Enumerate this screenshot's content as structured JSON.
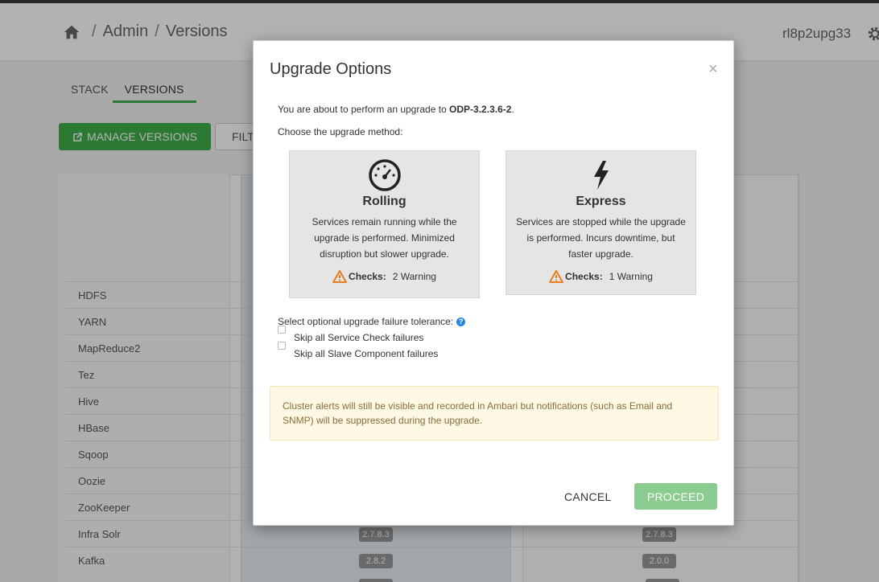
{
  "header": {
    "breadcrumb": [
      "Admin",
      "Versions"
    ],
    "user": "rl8p2upg33"
  },
  "tabs": [
    "STACK",
    "VERSIONS"
  ],
  "toolbar": {
    "manage_label": "MANAGE VERSIONS",
    "filter_label": "FILT"
  },
  "services": [
    "HDFS",
    "YARN",
    "MapReduce2",
    "Tez",
    "Hive",
    "HBase",
    "Sqoop",
    "Oozie",
    "ZooKeeper",
    "Infra Solr",
    "Kafka"
  ],
  "version_badges": [
    {
      "current": "2.7.8.3",
      "new": "2.7.8.3"
    },
    {
      "current": "2.8.2",
      "new": "2.0.0"
    }
  ],
  "modal": {
    "title": "Upgrade Options",
    "close": "×",
    "intro_prefix": "You are about to perform an upgrade to ",
    "target_version": "ODP-3.2.3.6-2",
    "intro_suffix": ".",
    "choose": "Choose the upgrade method:",
    "methods": [
      {
        "name": "Rolling",
        "description": "Services remain running while the upgrade is performed. Minimized disruption but slower upgrade.",
        "checks_label": "Checks:",
        "checks_value": "2 Warning"
      },
      {
        "name": "Express",
        "description": "Services are stopped while the upgrade is performed. Incurs downtime, but faster upgrade.",
        "checks_label": "Checks:",
        "checks_value": "1 Warning"
      }
    ],
    "tolerance_label": "Select optional upgrade failure tolerance:",
    "options": [
      "Skip all Service Check failures",
      "Skip all Slave Component failures"
    ],
    "alert": "Cluster alerts will still be visible and recorded in Ambari but notifications (such as Email and SNMP) will be suppressed during the upgrade.",
    "cancel_label": "CANCEL",
    "proceed_label": "PROCEED"
  },
  "colors": {
    "accent_green": "#3fae49",
    "proceed_disabled": "#8ccb8f",
    "warning": "#e67e22",
    "help_blue": "#1e88e5"
  }
}
